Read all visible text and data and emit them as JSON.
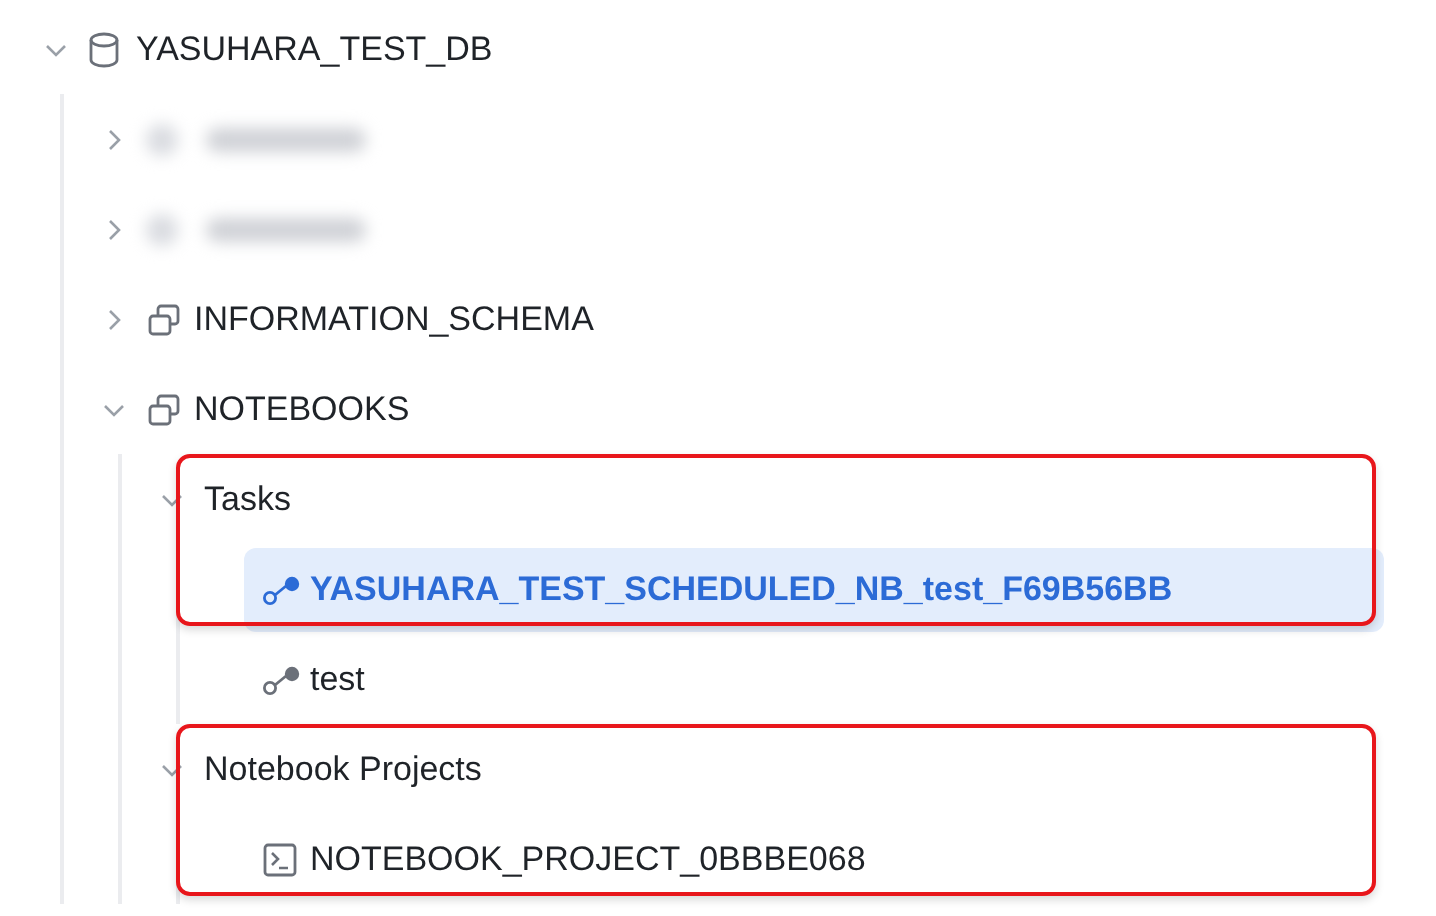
{
  "tree": {
    "label": "YASUHARA_TEST_DB",
    "kind": "database",
    "expanded": true,
    "children": [
      {
        "kind": "redacted",
        "expanded": false
      },
      {
        "kind": "redacted",
        "expanded": false
      },
      {
        "label": "INFORMATION_SCHEMA",
        "kind": "schema",
        "expanded": false
      },
      {
        "label": "NOTEBOOKS",
        "kind": "schema",
        "expanded": true,
        "children": [
          {
            "label": "Tasks",
            "kind": "folder",
            "expanded": true,
            "annotated": true,
            "children": [
              {
                "label": "YASUHARA_TEST_SCHEDULED_NB_test_F69B56BB",
                "kind": "task",
                "selected": true,
                "annotated": true
              },
              {
                "label": "test",
                "kind": "task",
                "selected": false,
                "annotated": false
              }
            ]
          },
          {
            "label": "Notebook Projects",
            "kind": "folder",
            "expanded": true,
            "annotated": true,
            "children": [
              {
                "label": "NOTEBOOK_PROJECT_0BBBE068",
                "kind": "project",
                "selected": false,
                "annotated": true
              }
            ]
          }
        ]
      }
    ]
  }
}
